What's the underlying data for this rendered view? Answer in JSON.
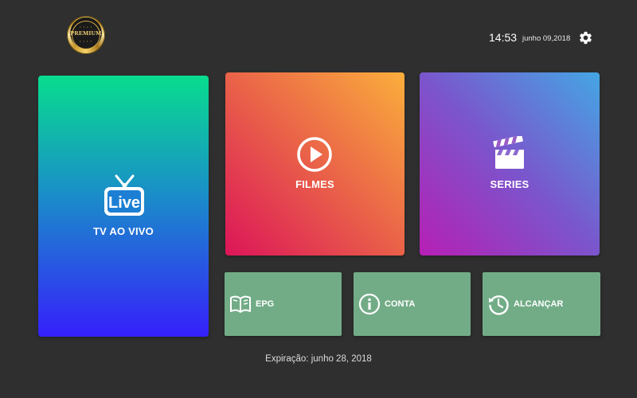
{
  "logo": {
    "text": "PREMIUM",
    "gold_color": "#d9ac45"
  },
  "header": {
    "time": "14:53",
    "date": "junho 09,2018",
    "settings_icon": "gear-icon"
  },
  "tiles": {
    "live": {
      "label": "TV AO VIVO",
      "badge": "Live",
      "icon": "live-tv-icon"
    },
    "filmes": {
      "label": "FILMES",
      "icon": "play-circle-icon"
    },
    "series": {
      "label": "SERIES",
      "icon": "clapperboard-icon"
    },
    "epg": {
      "label": "EPG",
      "icon": "book-icon"
    },
    "conta": {
      "label": "CONTA",
      "icon": "info-icon"
    },
    "alcancar": {
      "label": "ALCANÇAR",
      "icon": "history-icon"
    }
  },
  "footer": {
    "expiry_label": "Expiração:",
    "expiry_date": "junho 28, 2018"
  },
  "colors": {
    "background": "#2f2f2f",
    "small_tile": "#72ac87",
    "live_top": "#08dd8e",
    "live_bottom": "#3520fb",
    "filmes_start": "#dc1559",
    "filmes_end": "#fbae3c",
    "series_start": "#b61fb4",
    "series_end": "#44a6e4"
  }
}
